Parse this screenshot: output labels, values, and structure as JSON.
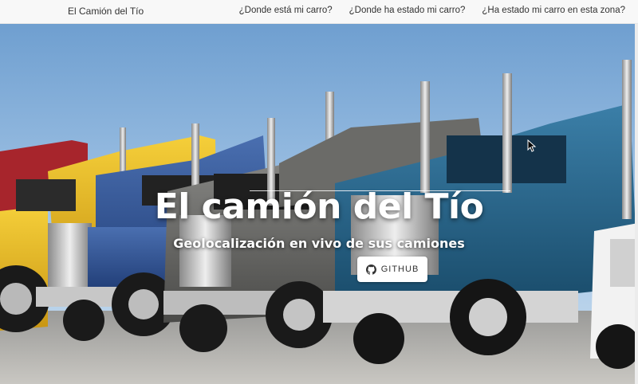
{
  "navbar": {
    "brand": "El Camión del Tío",
    "links": [
      "¿Donde está mi carro?",
      "¿Donde ha estado mi carro?",
      "¿Ha estado mi carro en esta zona?"
    ]
  },
  "hero": {
    "title": "El camión del Tío",
    "subtitle": "Geolocalización en vivo de sus camiones",
    "button_label": "GITHUB",
    "button_icon": "github-icon",
    "background": "trucks-photo"
  },
  "colors": {
    "navbar_bg": "#f8f8f8",
    "sky": "#87b3da",
    "truck_yellow": "#e8b81a",
    "truck_blue": "#2b4f8e",
    "truck_gray": "#5f5f5f",
    "truck_teal": "#1f5a80"
  }
}
